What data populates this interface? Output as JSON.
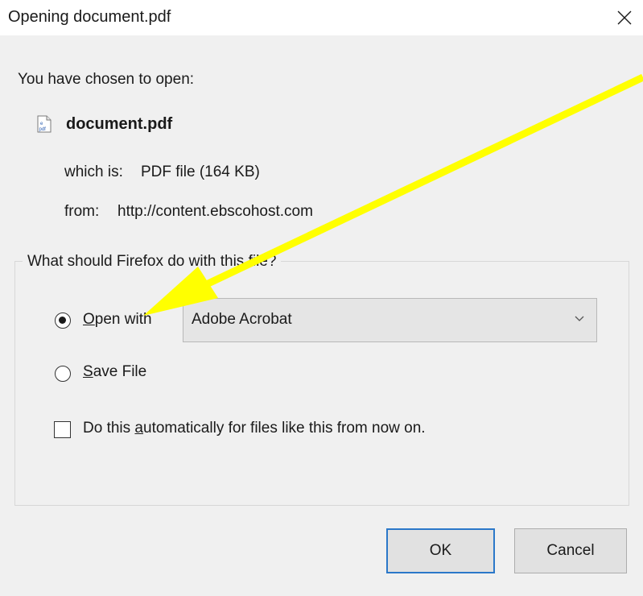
{
  "window": {
    "title": "Opening document.pdf",
    "close_glyph": "×"
  },
  "intro": "You have chosen to open:",
  "file": {
    "icon": "pdf-file-icon",
    "name": "document.pdf",
    "which_is_label": "which is:",
    "which_is_value": "PDF file (164 KB)",
    "from_label": "from:",
    "from_value": "http://content.ebscohost.com"
  },
  "action_group": {
    "legend": "What should Firefox do with this file?",
    "open_with": {
      "accesskey": "O",
      "rest": "pen with",
      "selected": true,
      "app": "Adobe Acrobat"
    },
    "save_file": {
      "accesskey": "S",
      "rest": "ave File",
      "selected": false
    },
    "auto": {
      "before": "Do this ",
      "accesskey": "a",
      "after": "utomatically for files like this from now on.",
      "checked": false
    }
  },
  "buttons": {
    "ok": "OK",
    "cancel": "Cancel"
  },
  "annotation": {
    "arrow_color": "#ffff00"
  },
  "colors": {
    "dialog_bg": "#f0f0f0",
    "default_button_border": "#2b78c9"
  }
}
